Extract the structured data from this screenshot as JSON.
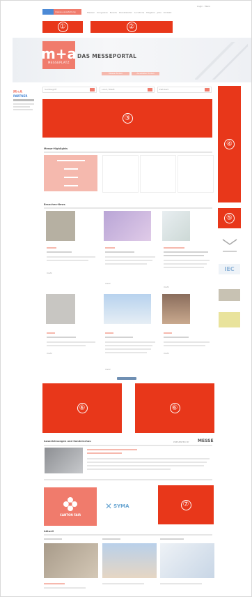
{
  "header": {
    "logo": "messe+ausstellung",
    "top_links": "Login · Menü",
    "nav_items": [
      "Messen",
      "Kongresse",
      "Events",
      "Dienstleister",
      "Locations",
      "Magazin",
      "Jobs",
      "Kontakt"
    ]
  },
  "hero": {
    "logo_text": "m+a",
    "logo_sub": "MESSEPLATZ",
    "tagline": "DAS MESSEPORTAL",
    "buttons": [
      "Messe finden",
      "Aussteller finden"
    ]
  },
  "search": {
    "fields": [
      "Suchbegriff",
      "Land / Stadt",
      "Zeitraum"
    ]
  },
  "sidebar_left": {
    "logo_lines": [
      "M+A",
      "PARTNER"
    ]
  },
  "sections": {
    "messe_tipps": "Messe-Highlights",
    "news": "Branchen-News",
    "more": "mehr",
    "event_teaser": "Auszeichnungen und Sonderschau",
    "aktuell": "Aktuell",
    "presented_by": "PRESENTED BY",
    "presented_brand": "MESSE"
  },
  "ads": [
    {
      "id": "ad-1",
      "number": "①"
    },
    {
      "id": "ad-2",
      "number": "②"
    },
    {
      "id": "ad-3",
      "number": "③"
    },
    {
      "id": "ad-4",
      "number": "④"
    },
    {
      "id": "ad-5",
      "number": "⑤"
    },
    {
      "id": "ad-6a",
      "number": "⑥"
    },
    {
      "id": "ad-6b",
      "number": "⑥"
    },
    {
      "id": "ad-7",
      "number": "⑦"
    }
  ],
  "partner_logos": [
    "CANTON FAIR",
    "SYMA"
  ],
  "colors": {
    "ad_red": "#e8371a",
    "brand_pink": "#f07b6c",
    "light_pink": "#f5b9ae"
  }
}
